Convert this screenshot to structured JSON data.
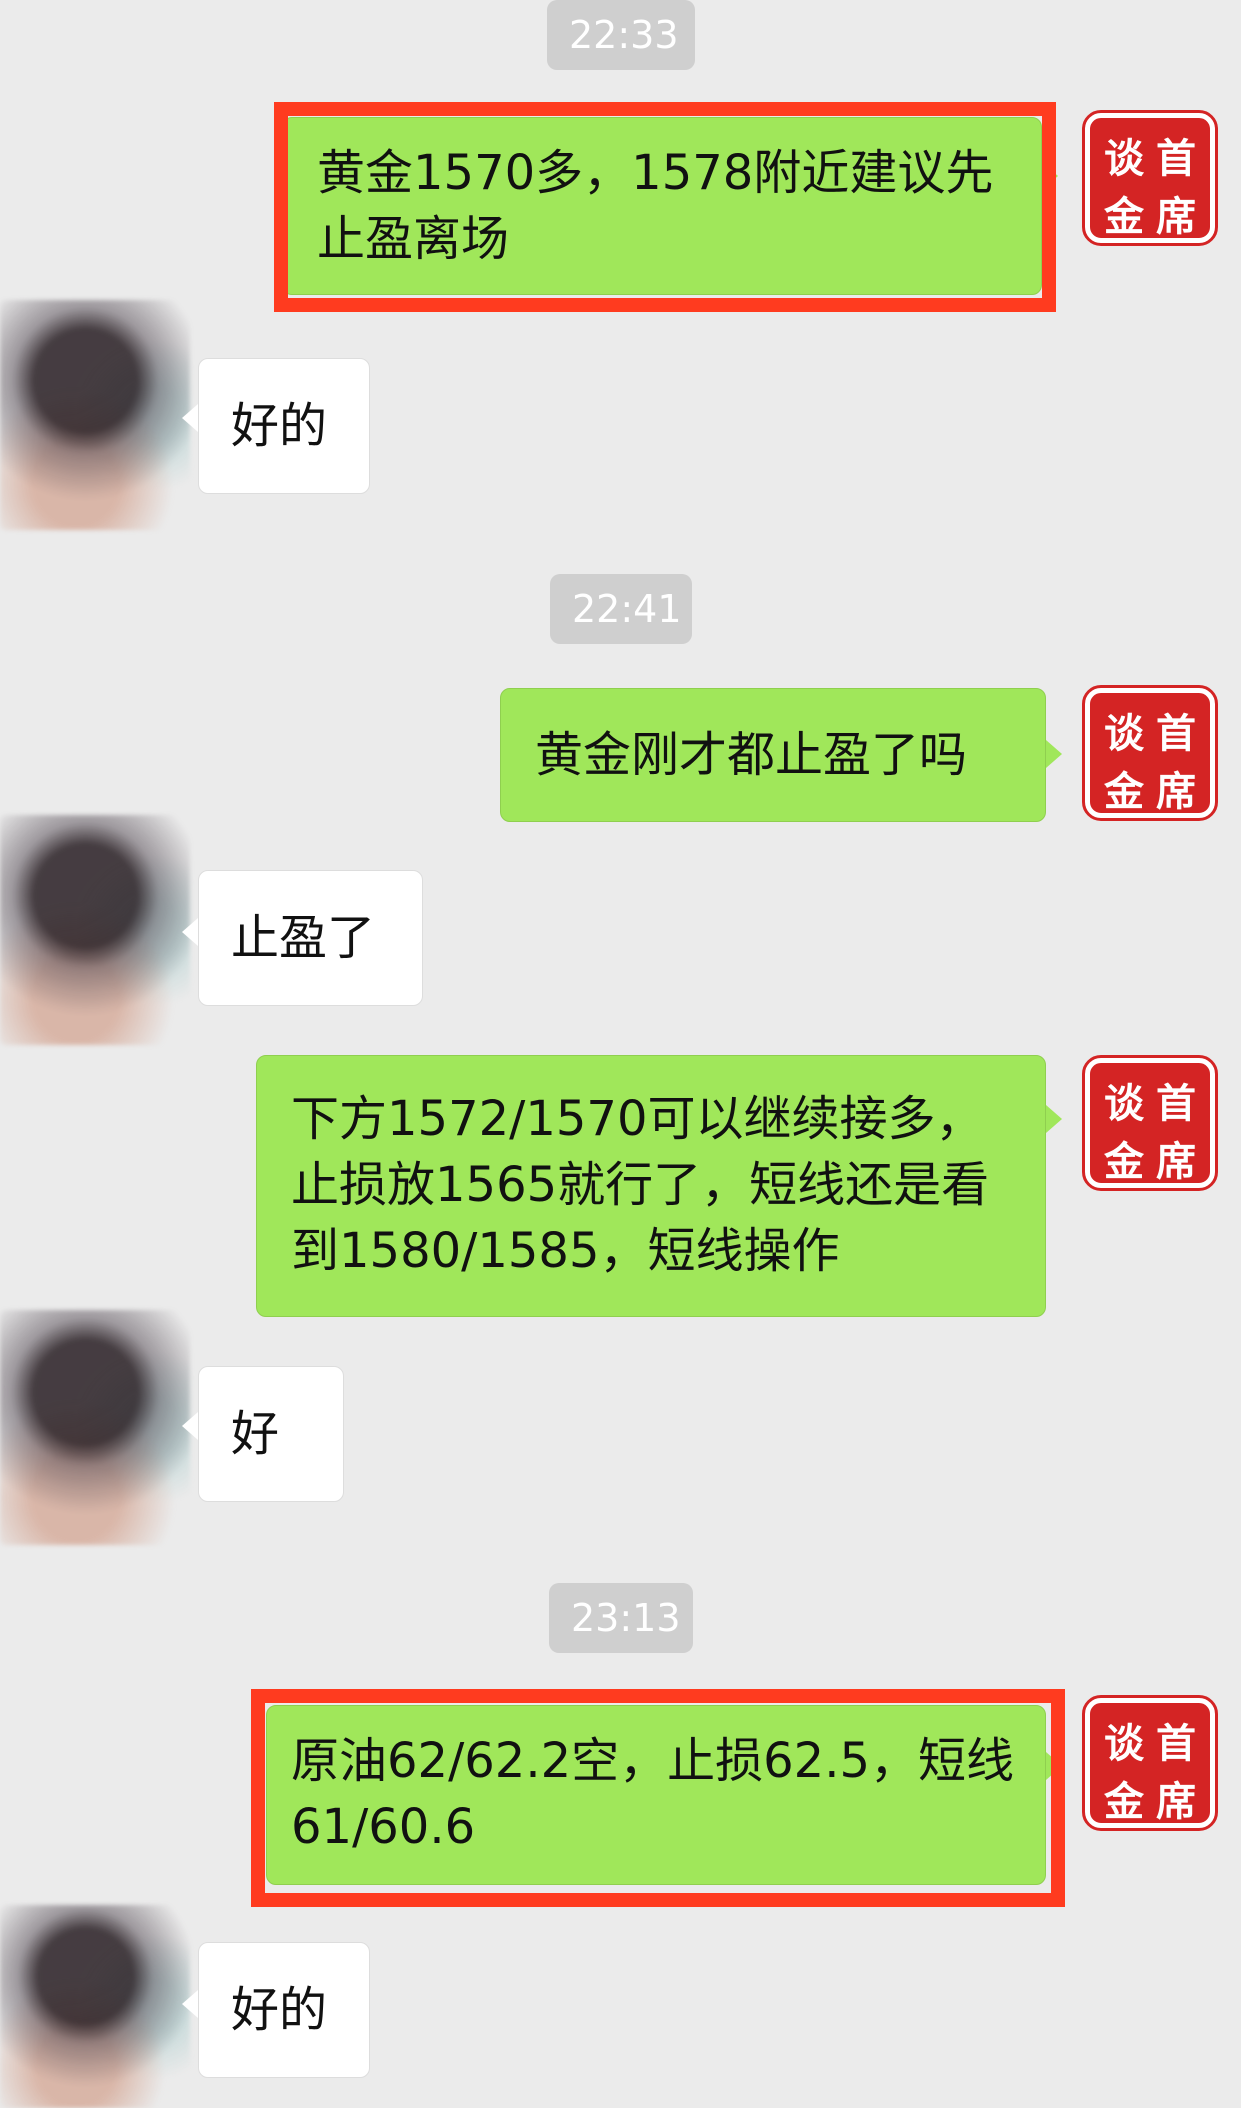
{
  "timestamps": [
    "22:33",
    "22:41",
    "23:13"
  ],
  "seal": {
    "chars": [
      "谈",
      "首",
      "金",
      "席"
    ]
  },
  "messages": [
    {
      "from": "me",
      "text": "黄金1570多，1578附近建议先止盈离场",
      "highlighted": true
    },
    {
      "from": "peer",
      "text": "好的"
    },
    {
      "from": "me",
      "text": "黄金刚才都止盈了吗",
      "highlighted": false
    },
    {
      "from": "peer",
      "text": "止盈了"
    },
    {
      "from": "me",
      "text": "下方1572/1570可以继续接多，止损放1565就行了，短线还是看到1580/1585，短线操作",
      "highlighted": false
    },
    {
      "from": "peer",
      "text": "好"
    },
    {
      "from": "me",
      "text": "原油62/62.2空，止损62.5，短线61/60.6",
      "highlighted": true
    },
    {
      "from": "peer",
      "text": "好的"
    }
  ],
  "colors": {
    "background": "#ebebeb",
    "outgoing_bubble": "#a0e75a",
    "incoming_bubble": "#ffffff",
    "highlight_border": "#ff3b1f",
    "seal_red": "#d42424",
    "timestamp_bg": "#cfcfcf"
  },
  "icons": {
    "avatar_self": "red-seal-avatar",
    "avatar_peer": "blurred-photo-avatar"
  }
}
